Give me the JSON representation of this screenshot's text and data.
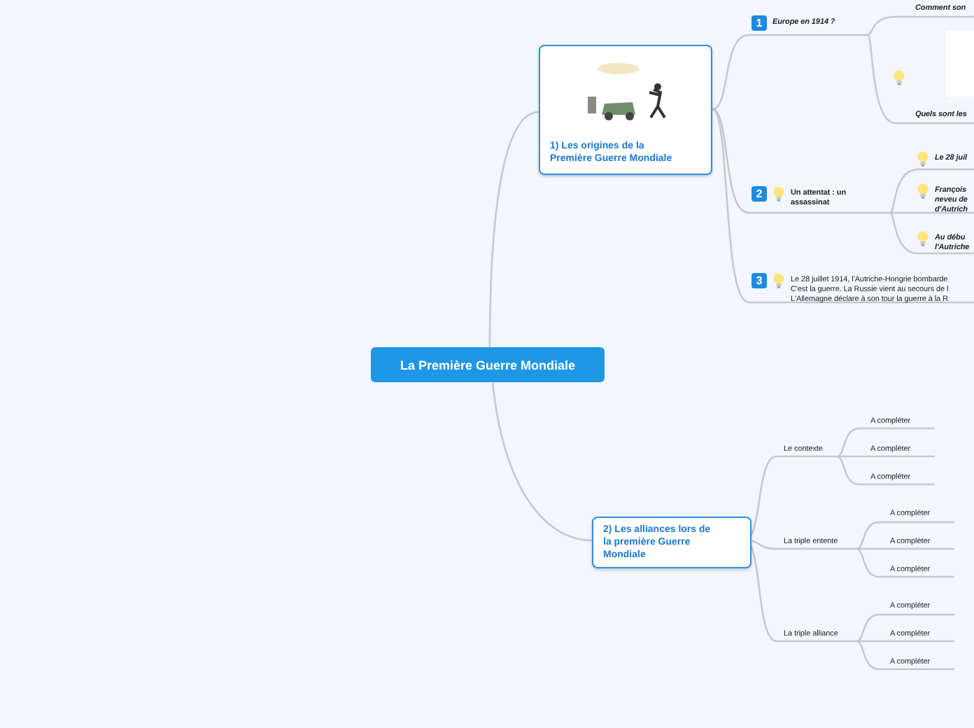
{
  "central_topic": {
    "title": "La Première Guerre Mondiale"
  },
  "branches": [
    {
      "title_lines": [
        "1) Les origines de la",
        "Première Guerre Mondiale"
      ],
      "illustration": true,
      "subtopics": [
        {
          "marker": "1",
          "bulb": false,
          "kind": "bold-italic",
          "lines": [
            "Europe en 1914 ?"
          ],
          "children": [
            {
              "bulb": false,
              "image": false,
              "lines": [
                "Comment son"
              ]
            },
            {
              "bulb": true,
              "image": true,
              "lines": [
                "Quels sont les"
              ]
            }
          ]
        },
        {
          "marker": "2",
          "bulb": true,
          "kind": "bold",
          "lines": [
            "Un attentat : un",
            "assassinat"
          ],
          "children": [
            {
              "bulb": true,
              "image": false,
              "lines": [
                "Le 28 juil"
              ]
            },
            {
              "bulb": true,
              "image": false,
              "lines": [
                "François",
                "neveu de",
                "d'Autrich"
              ]
            },
            {
              "bulb": true,
              "image": false,
              "lines": [
                "Au débu",
                "l'Autriche"
              ]
            }
          ]
        },
        {
          "marker": "3",
          "bulb": true,
          "kind": "plain",
          "lines": [
            "Le 28 juillet 1914, l'Autriche-Hongrie bombarde",
            "C'est la guerre. La Russie vient au secours de l",
            "L'Allemagne déclare à son tour la guerre à la R"
          ]
        }
      ]
    },
    {
      "title_lines": [
        "2) Les alliances lors de",
        "la première Guerre",
        "Mondiale"
      ],
      "illustration": false,
      "subtopics": [
        {
          "kind": "plain",
          "lines": [
            "Le contexte"
          ],
          "children": [
            {
              "lines": [
                "A compléter"
              ]
            },
            {
              "lines": [
                "A compléter"
              ]
            },
            {
              "lines": [
                "A compléter"
              ]
            }
          ]
        },
        {
          "kind": "plain",
          "lines": [
            "La triple entente"
          ],
          "children": [
            {
              "lines": [
                "A compléter"
              ]
            },
            {
              "lines": [
                "A compléter"
              ]
            },
            {
              "lines": [
                "A compléter"
              ]
            }
          ]
        },
        {
          "kind": "plain",
          "lines": [
            "La triple alliance"
          ],
          "children": [
            {
              "lines": [
                "A compléter"
              ]
            },
            {
              "lines": [
                "A compléter"
              ]
            },
            {
              "lines": [
                "A compléter"
              ]
            }
          ]
        }
      ]
    }
  ]
}
